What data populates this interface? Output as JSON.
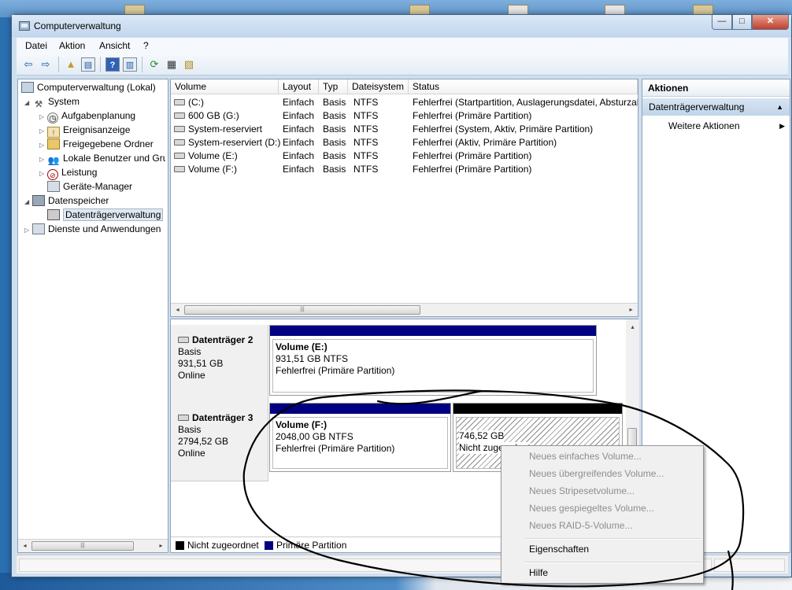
{
  "window": {
    "title": "Computerverwaltung",
    "buttons": {
      "minimize": "—",
      "maximize": "□",
      "close": "✕"
    }
  },
  "menubar": [
    "Datei",
    "Aktion",
    "Ansicht",
    "?"
  ],
  "toolbar": {
    "icons": [
      "back-arrow",
      "forward-arrow",
      "up-folder",
      "show-hide-tree",
      "help",
      "show-hide-action-pane",
      "refresh",
      "properties",
      "export"
    ],
    "glyphs": {
      "back": "⇦",
      "forward": "⇨",
      "up": "▲",
      "tree": "▤",
      "help": "?",
      "pane": "▥",
      "refresh": "⟳",
      "props": "▦",
      "export": "▧"
    }
  },
  "tree": {
    "items": [
      {
        "label": "Computerverwaltung (Lokal)",
        "icon": "computer-icon",
        "glyph": "",
        "expander": ""
      },
      {
        "label": "System",
        "icon": "system-tools-icon",
        "glyph": "⚒",
        "expander": "◢"
      },
      {
        "label": "Aufgabenplanung",
        "icon": "task-scheduler-icon",
        "glyph": "◷",
        "expander": "▷"
      },
      {
        "label": "Ereignisanzeige",
        "icon": "event-viewer-icon",
        "glyph": "!",
        "expander": "▷"
      },
      {
        "label": "Freigegebene Ordner",
        "icon": "shared-folder-icon",
        "glyph": "",
        "expander": "▷"
      },
      {
        "label": "Lokale Benutzer und Gruppen",
        "icon": "users-icon",
        "glyph": "👥",
        "expander": "▷"
      },
      {
        "label": "Leistung",
        "icon": "performance-icon",
        "glyph": "⊘",
        "expander": "▷"
      },
      {
        "label": "Geräte-Manager",
        "icon": "device-manager-icon",
        "glyph": "",
        "expander": ""
      },
      {
        "label": "Datenspeicher",
        "icon": "storage-icon",
        "glyph": "",
        "expander": "◢"
      },
      {
        "label": "Datenträgerverwaltung",
        "icon": "disk-management-icon",
        "glyph": "",
        "expander": ""
      },
      {
        "label": "Dienste und Anwendungen",
        "icon": "services-icon",
        "glyph": "",
        "expander": "▷"
      }
    ]
  },
  "volume_list": {
    "columns": [
      "Volume",
      "Layout",
      "Typ",
      "Dateisystem",
      "Status"
    ],
    "rows": [
      {
        "volume": "(C:)",
        "layout": "Einfach",
        "typ": "Basis",
        "fs": "NTFS",
        "status": "Fehlerfrei (Startpartition, Auslagerungsdatei, Absturzab"
      },
      {
        "volume": "600 GB (G:)",
        "layout": "Einfach",
        "typ": "Basis",
        "fs": "NTFS",
        "status": "Fehlerfrei (Primäre Partition)"
      },
      {
        "volume": "System-reserviert",
        "layout": "Einfach",
        "typ": "Basis",
        "fs": "NTFS",
        "status": "Fehlerfrei (System, Aktiv, Primäre Partition)"
      },
      {
        "volume": "System-reserviert (D:)",
        "layout": "Einfach",
        "typ": "Basis",
        "fs": "NTFS",
        "status": "Fehlerfrei (Aktiv, Primäre Partition)"
      },
      {
        "volume": "Volume (E:)",
        "layout": "Einfach",
        "typ": "Basis",
        "fs": "NTFS",
        "status": "Fehlerfrei (Primäre Partition)"
      },
      {
        "volume": "Volume (F:)",
        "layout": "Einfach",
        "typ": "Basis",
        "fs": "NTFS",
        "status": "Fehlerfrei (Primäre Partition)"
      }
    ]
  },
  "disks": [
    {
      "name": "Datenträger 2",
      "type": "Basis",
      "size": "931,51 GB",
      "state": "Online",
      "partitions": [
        {
          "name": "Volume  (E:)",
          "size": "931,51 GB NTFS",
          "status": "Fehlerfrei (Primäre Partition)"
        }
      ]
    },
    {
      "name": "Datenträger 3",
      "type": "Basis",
      "size": "2794,52 GB",
      "state": "Online",
      "partitions": [
        {
          "name": "Volume  (F:)",
          "size": "2048,00 GB NTFS",
          "status": "Fehlerfrei (Primäre Partition)"
        },
        {
          "size": "746,52 GB",
          "status": "Nicht zugeordnet"
        }
      ]
    }
  ],
  "legend": [
    {
      "label": "Nicht zugeordnet",
      "color": "#000000"
    },
    {
      "label": "Primäre Partition",
      "color": "#000080"
    }
  ],
  "actions": {
    "header": "Aktionen",
    "section": "Datenträgerverwaltung",
    "items": [
      "Weitere Aktionen"
    ],
    "glyphs": {
      "collapse": "▲",
      "submenu": "▶"
    }
  },
  "context_menu": {
    "items": [
      {
        "label": "Neues einfaches Volume...",
        "enabled": false
      },
      {
        "label": "Neues übergreifendes Volume...",
        "enabled": false
      },
      {
        "label": "Neues Stripesetvolume...",
        "enabled": false
      },
      {
        "label": "Neues gespiegeltes Volume...",
        "enabled": false
      },
      {
        "label": "Neues RAID-5-Volume...",
        "enabled": false
      },
      {
        "label": "Eigenschaften",
        "enabled": true
      },
      {
        "label": "Hilfe",
        "enabled": true
      }
    ]
  },
  "scrollbar": {
    "left": "◂",
    "right": "▸",
    "up": "▴",
    "down": "▾",
    "grip": "|||"
  },
  "colors": {
    "primary_partition": "#000080",
    "unallocated": "#000000",
    "scribble": "#000000"
  }
}
